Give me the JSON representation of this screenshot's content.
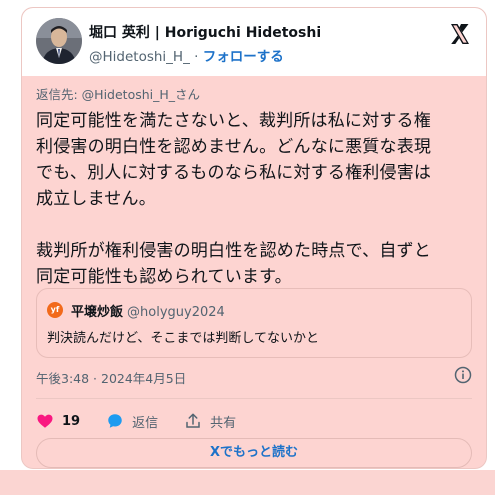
{
  "author": {
    "name": "堀口 英利 | Horiguchi Hidetoshi",
    "handle": "@Hidetoshi_H_",
    "separator": "·",
    "follow_label": "フォローする"
  },
  "reply_to": "返信先: @Hidetoshi_H_さん",
  "tweet_text": "同定可能性を満たさないと、裁判所は私に対する権\n利侵害の明白性を認めません。どんなに悪質な表現\nでも、別人に対するものなら私に対する権利侵害は\n成立しません。\n\n裁判所が権利侵害の明白性を認めた時点で、自ずと\n同定可能性も認められています。",
  "quote": {
    "avatar_text": "yf",
    "name": "平壌炒飯",
    "handle": "@holyguy2024",
    "text": "判決読んだけど、そこまでは判断してないかと"
  },
  "timestamp": "午後3:48 · 2024年4月5日",
  "actions": {
    "like_count": "19",
    "reply_label": "返信",
    "share_label": "共有"
  },
  "read_more_label": "Xでもっと読む",
  "colors": {
    "card_bg": "#fdd4d1",
    "accent": "#1d72c9",
    "like": "#f91880"
  }
}
